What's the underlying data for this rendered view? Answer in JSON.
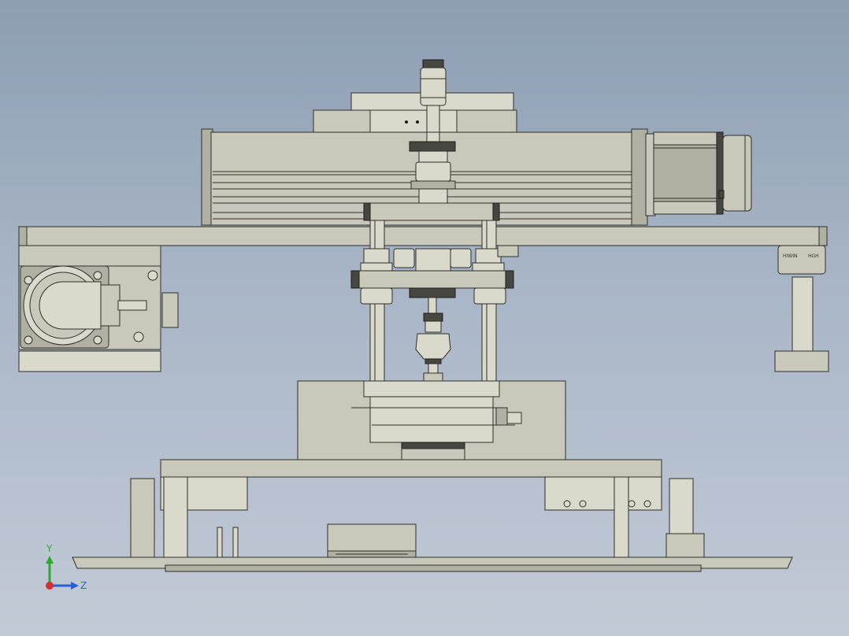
{
  "viewport": {
    "background_top": "#8d9db2",
    "background_bottom": "#c2cad6"
  },
  "model": {
    "part_color": "#c9c9bb",
    "edge_color": "#2e2e2a",
    "rail_tags": [
      "HIWIN",
      "HGH"
    ]
  },
  "triad": {
    "axes": [
      {
        "label": "Y",
        "color": "#2ea82e"
      },
      {
        "label": "Z",
        "color": "#2a5fd6"
      }
    ],
    "origin_color": "#d43030"
  }
}
